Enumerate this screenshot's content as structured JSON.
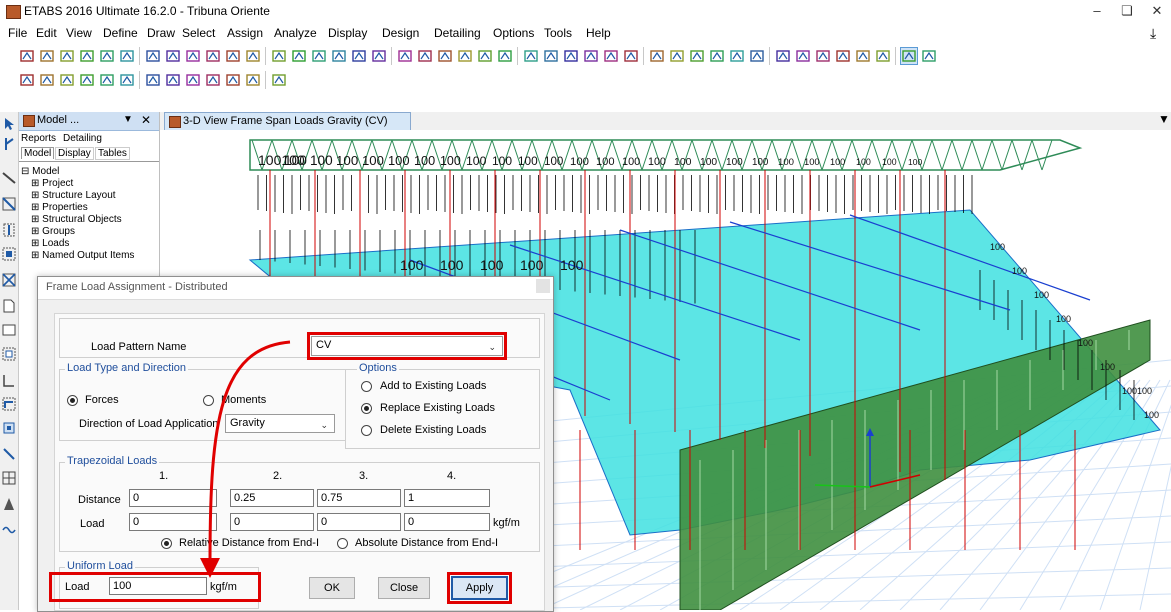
{
  "window": {
    "title": "ETABS 2016 Ultimate 16.2.0 - Tribuna Oriente"
  },
  "menu": [
    "File",
    "Edit",
    "View",
    "Define",
    "Draw",
    "Select",
    "Assign",
    "Analyze",
    "Display",
    "Design",
    "Detailing",
    "Options",
    "Tools",
    "Help"
  ],
  "explorer": {
    "tab_title": "Model ...",
    "tabs_row1": [
      "Reports",
      "Detailing"
    ],
    "tabs_row2": [
      "Model",
      "Display",
      "Tables"
    ],
    "tree": [
      "Model",
      "Project",
      "Structure Layout",
      "Properties",
      "Structural Objects",
      "Groups",
      "Loads",
      "Named Output Items"
    ]
  },
  "view": {
    "tab_title": "3-D View  Frame Span Loads Gravity (CV)",
    "load_labels": [
      "100100",
      "100",
      "100",
      "100",
      "100",
      "100",
      "100",
      "100",
      "100",
      "100",
      "100",
      "100",
      "100",
      "100",
      "100",
      "100",
      "100",
      "100",
      "100",
      "100",
      "100",
      "100",
      "100",
      "100",
      "100",
      "100",
      "100",
      "100",
      "100",
      "100",
      "100",
      "100",
      "100",
      "100",
      "100",
      "100",
      "100",
      "100100",
      "100"
    ]
  },
  "dialog": {
    "title": "Frame Load Assignment - Distributed",
    "load_pattern_label": "Load Pattern Name",
    "load_pattern_value": "CV",
    "load_type_group": "Load Type and Direction",
    "forces_label": "Forces",
    "moments_label": "Moments",
    "direction_label": "Direction of Load Application",
    "direction_value": "Gravity",
    "options_group": "Options",
    "opt_add": "Add to Existing Loads",
    "opt_replace": "Replace Existing Loads",
    "opt_delete": "Delete Existing Loads",
    "trap_group": "Trapezoidal Loads",
    "col_headers": [
      "1.",
      "2.",
      "3.",
      "4."
    ],
    "distance_label": "Distance",
    "distances": [
      "0",
      "0.25",
      "0.75",
      "1"
    ],
    "load_label": "Load",
    "loads": [
      "0",
      "0",
      "0",
      "0"
    ],
    "trap_unit": "kgf/m",
    "relative_label": "Relative Distance from End-I",
    "absolute_label": "Absolute Distance from End-I",
    "uniform_group": "Uniform Load",
    "uniform_load_label": "Load",
    "uniform_load_value": "100",
    "uniform_unit": "kgf/m",
    "ok": "OK",
    "close": "Close",
    "apply": "Apply"
  },
  "colors": {
    "highlight": "#e00000",
    "slab": "#40e0e0",
    "wall": "#3f8f3f",
    "load_arrow": "#000000",
    "roof_truss": "#2e8b57"
  }
}
